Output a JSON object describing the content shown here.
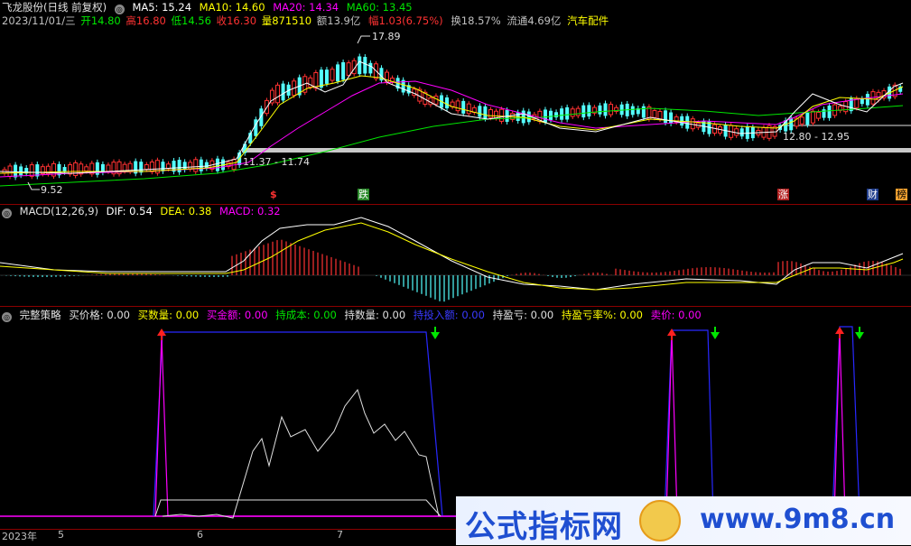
{
  "kline_header": {
    "title": "飞龙股份(日线 前复权)",
    "ma5": "MA5: 15.24",
    "ma10": "MA10: 14.60",
    "ma20": "MA20: 14.34",
    "ma60": "MA60: 13.45",
    "quote_date": "2023/11/01/三",
    "open": "开14.80",
    "high": "高16.80",
    "low": "低14.56",
    "close": "收16.30",
    "volume": "量871510",
    "amount": "额13.9亿",
    "change": "幅1.03(6.75%)",
    "turnover": "换18.57%",
    "float_value": "流通4.69亿",
    "industry": "汽车配件"
  },
  "price_labels": {
    "peak": "17.89",
    "low": "9.52",
    "range_left": "11.37 - 11.74",
    "range_right": "12.80 - 12.95"
  },
  "event_tags": {
    "s": "$",
    "die": "跌",
    "zhang": "涨",
    "cai": "财",
    "bang": "榜"
  },
  "macd_header": {
    "name": "MACD(12,26,9)",
    "dif": "DIF: 0.54",
    "dea": "DEA: 0.38",
    "macd": "MACD: 0.32"
  },
  "strategy_header": {
    "name": "完整策略",
    "buy_price": "买价格: 0.00",
    "buy_qty": "买数量: 0.00",
    "buy_amt": "买金额: 0.00",
    "hold_cost": "持成本: 0.00",
    "hold_qty": "持数量: 0.00",
    "hold_invest": "持投入额: 0.00",
    "hold_pl": "持盈亏: 0.00",
    "hold_pl_rate": "持盈亏率%: 0.00",
    "sell_price": "卖价: 0.00"
  },
  "time_axis": {
    "year": "2023年",
    "m5": "5",
    "m6": "6",
    "m7": "7"
  },
  "watermark": {
    "text1": "公式指标网",
    "text2": "www.9m8.cn"
  },
  "colors": {
    "up": "#ff3232",
    "down": "#54ffff",
    "ma5": "#ffffff",
    "ma10": "#ffff00",
    "ma20": "#ff00ff",
    "ma60": "#00e600",
    "border": "#8b0000"
  }
}
